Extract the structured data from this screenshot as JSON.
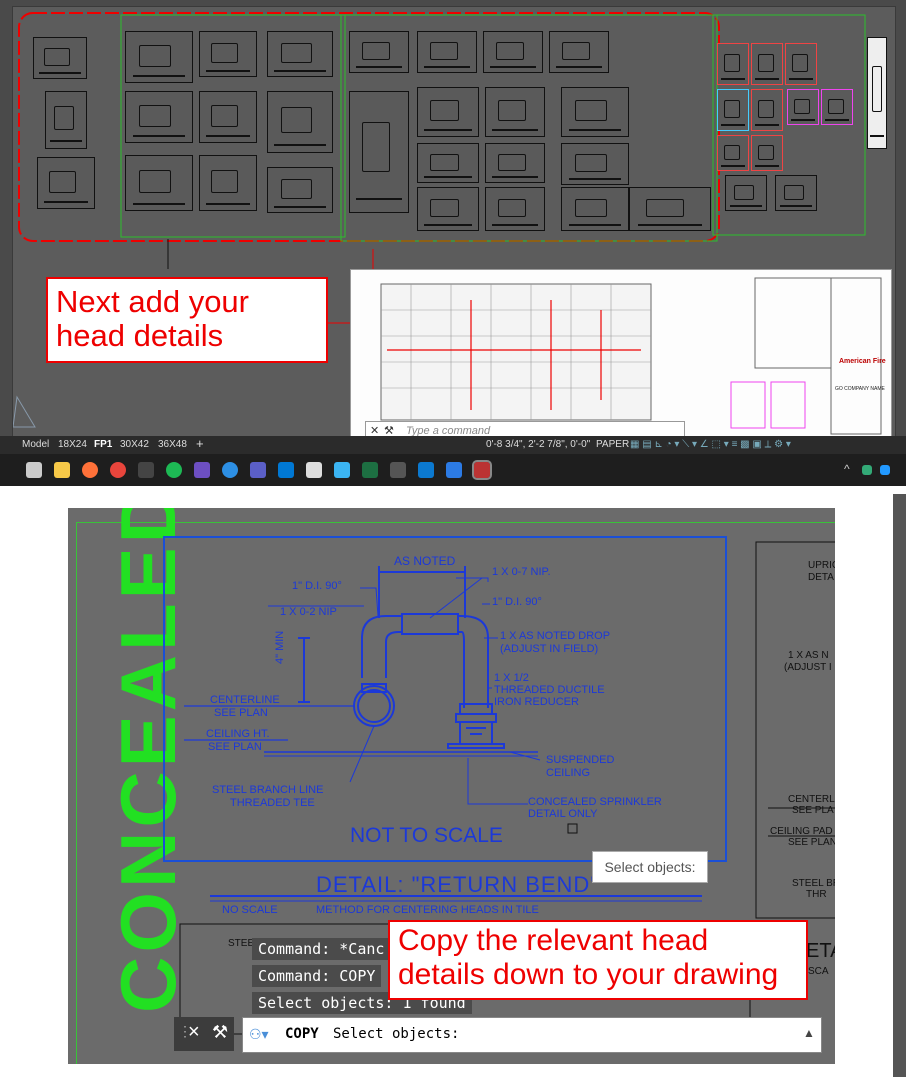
{
  "top": {
    "callout": "Next add your head details",
    "command_placeholder": "Type a command",
    "tabs": [
      "Model",
      "18X24",
      "FP1",
      "30X42",
      "36X48",
      "+"
    ],
    "active_tab": "FP1",
    "coordinates": "0'-8 3/4\", 2'-2 7/8\", 0'-0\"",
    "space": "PAPER",
    "company_logo": "American Fire",
    "company_name": "GO COMPANY NAME"
  },
  "bottom": {
    "side_label": "CONCEALED",
    "detail": {
      "as_noted": "AS NOTED",
      "di90_left": "1\" D.I. 90°",
      "nip_left": "1 X 0-2 NIP",
      "nip_top": "1 X 0-7 NIP.",
      "di90_right": "1\" D.I. 90°",
      "drop_1": "1 X AS NOTED DROP",
      "drop_2": "(ADJUST IN FIELD)",
      "reducer_1": "1 X 1/2",
      "reducer_2": "THREADED DUCTILE",
      "reducer_3": "IRON REDUCER",
      "min": "4\" MIN",
      "centerline_1": "CENTERLINE",
      "centerline_2": "SEE PLAN",
      "ceiling_1": "CEILING HT.",
      "ceiling_2": "SEE PLAN",
      "suspended_1": "SUSPENDED",
      "suspended_2": "CEILING",
      "branch_1": "STEEL BRANCH LINE",
      "branch_2": "THREADED TEE",
      "conc_1": "CONCEALED SPRINKLER",
      "conc_2": "DETAIL ONLY",
      "not_to_scale": "NOT TO SCALE"
    },
    "detail_title": "DETAIL: \"RETURN BEND\"",
    "no_scale": "NO SCALE",
    "method": "METHOD FOR CENTERING HEADS IN TILE",
    "right_detail": {
      "upright_1": "UPRIG",
      "upright_2": "DETA",
      "noted_1": "1 X AS N",
      "noted_2": "(ADJUST I",
      "centerline_1": "CENTERLI",
      "centerline_2": "SEE PLA",
      "ceiling_pad_1": "CEILING PAD",
      "ceiling_pad_2": "SEE PLAN",
      "steel_1": "STEEL BR",
      "steel_2": "THR",
      "det_partial": "ETA",
      "scale_partial": "SCA"
    },
    "steel_branch_line": "STEEL BRANCH LINE",
    "select_tooltip": "Select objects:",
    "history": [
      "Command: *Canc",
      "Command: COPY",
      "Select objects: 1 found"
    ],
    "callout_1": "Copy the relevant head",
    "callout_2": "details down to your drawing",
    "command_name": "COPY",
    "command_prompt": "Select objects:"
  },
  "colors": {
    "accent_red": "#e00000",
    "cad_blue": "#1c39d8",
    "cad_green": "#22e022"
  }
}
